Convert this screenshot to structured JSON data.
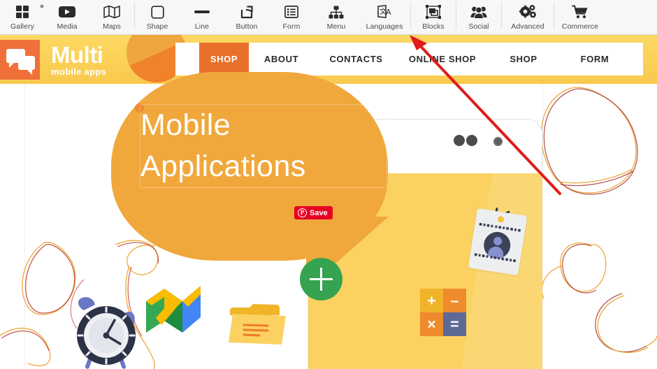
{
  "toolbar": {
    "groups": [
      {
        "items": [
          {
            "label": "Gallery",
            "icon": "gallery-grid-icon"
          },
          {
            "label": "Media",
            "icon": "media-play-icon"
          },
          {
            "label": "Maps",
            "icon": "maps-fold-icon"
          }
        ]
      },
      {
        "items": [
          {
            "label": "Shape",
            "icon": "shape-square-icon"
          },
          {
            "label": "Line",
            "icon": "line-icon"
          },
          {
            "label": "Button",
            "icon": "button-share-icon"
          },
          {
            "label": "Form",
            "icon": "form-list-icon"
          },
          {
            "label": "Menu",
            "icon": "menu-sitemap-icon"
          },
          {
            "label": "Languages",
            "icon": "languages-translate-icon"
          }
        ]
      },
      {
        "items": [
          {
            "label": "Blocks",
            "icon": "blocks-layers-icon"
          }
        ]
      },
      {
        "items": [
          {
            "label": "Social",
            "icon": "social-people-icon"
          }
        ]
      },
      {
        "items": [
          {
            "label": "Advanced",
            "icon": "advanced-gears-icon"
          }
        ]
      },
      {
        "items": [
          {
            "label": "Commerce",
            "icon": "commerce-cart-icon"
          }
        ]
      }
    ]
  },
  "site": {
    "logo": {
      "title": "Multi",
      "subtitle": "mobile apps",
      "icon": "speech-bubbles-logo-icon",
      "box_color": "#f0703c"
    },
    "nav": [
      {
        "label": "SHOP",
        "active": true
      },
      {
        "label": "ABOUT",
        "active": false
      },
      {
        "label": "CONTACTS",
        "active": false
      },
      {
        "label": "ONLINE SHOP",
        "active": false
      },
      {
        "label": "SHOP",
        "active": false
      },
      {
        "label": "FORM",
        "active": false
      }
    ],
    "hero": {
      "line1": "Mobile",
      "line2": "Applications",
      "bubble_color": "#f0a83c"
    },
    "banner_color": "#fbd055",
    "accent_color": "#e8702a"
  },
  "overlays": {
    "pinterest_save": {
      "label": "Save",
      "glyph": "P",
      "color": "#e60023",
      "icon": "pinterest-icon"
    },
    "add_button": {
      "glyph": "+",
      "color": "#36a350",
      "icon": "plus-circle-icon"
    },
    "annotation_arrow": {
      "color": "#e01b1b",
      "points_to": "Social"
    }
  },
  "illustration": {
    "calculator": {
      "keys": [
        "+",
        "–",
        "×",
        "="
      ]
    },
    "items": [
      {
        "name": "alarm-clock-icon"
      },
      {
        "name": "folded-map-icon"
      },
      {
        "name": "folder-icon"
      },
      {
        "name": "id-badge-icon"
      },
      {
        "name": "calculator-icon"
      },
      {
        "name": "phone-device-mockup"
      }
    ]
  }
}
